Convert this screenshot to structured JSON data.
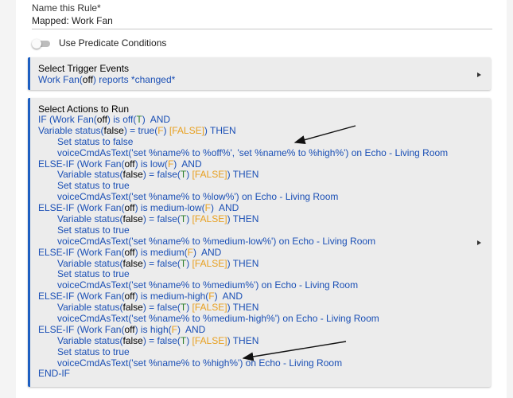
{
  "form": {
    "name_label": "Name this Rule*",
    "name_value": "Mapped: Work Fan",
    "predicate_label": "Use Predicate Conditions"
  },
  "triggers": {
    "title": "Select Trigger Events",
    "line_device": "Work Fan(",
    "line_state": "off",
    "line_rest": ") reports *changed*"
  },
  "actions": {
    "title": "Select Actions to Run",
    "lines": [
      {
        "indent": false,
        "segments": [
          [
            "blue",
            "IF (Work Fan("
          ],
          [
            "black",
            "off"
          ],
          [
            "blue",
            ") is off("
          ],
          [
            "green",
            "T"
          ],
          [
            "blue",
            ")  AND"
          ]
        ]
      },
      {
        "indent": false,
        "segments": [
          [
            "blue",
            "Variable status("
          ],
          [
            "black",
            "false"
          ],
          [
            "blue",
            ") = true("
          ],
          [
            "orange",
            "F"
          ],
          [
            "blue",
            ") "
          ],
          [
            "orange",
            "[FALSE]"
          ],
          [
            "blue",
            ") THEN"
          ]
        ]
      },
      {
        "indent": true,
        "segments": [
          [
            "blue",
            "Set status to false"
          ]
        ]
      },
      {
        "indent": true,
        "segments": [
          [
            "blue",
            "voiceCmdAsText('set %name% to %off%', 'set %name% to %high%') on Echo - Living Room"
          ]
        ]
      },
      {
        "indent": false,
        "segments": [
          [
            "blue",
            "ELSE-IF (Work Fan("
          ],
          [
            "black",
            "off"
          ],
          [
            "blue",
            ") is low("
          ],
          [
            "orange",
            "F"
          ],
          [
            "blue",
            ")  AND"
          ]
        ]
      },
      {
        "indent": true,
        "segments": [
          [
            "blue",
            "Variable status("
          ],
          [
            "black",
            "false"
          ],
          [
            "blue",
            ") = false("
          ],
          [
            "green",
            "T"
          ],
          [
            "blue",
            ") "
          ],
          [
            "orange",
            "[FALSE]"
          ],
          [
            "blue",
            ") THEN"
          ]
        ]
      },
      {
        "indent": true,
        "segments": [
          [
            "blue",
            "Set status to true"
          ]
        ]
      },
      {
        "indent": true,
        "segments": [
          [
            "blue",
            "voiceCmdAsText('set %name% to %low%') on Echo - Living Room"
          ]
        ]
      },
      {
        "indent": false,
        "segments": [
          [
            "blue",
            "ELSE-IF (Work Fan("
          ],
          [
            "black",
            "off"
          ],
          [
            "blue",
            ") is medium-low("
          ],
          [
            "orange",
            "F"
          ],
          [
            "blue",
            ")  AND"
          ]
        ]
      },
      {
        "indent": true,
        "segments": [
          [
            "blue",
            "Variable status("
          ],
          [
            "black",
            "false"
          ],
          [
            "blue",
            ") = false("
          ],
          [
            "green",
            "T"
          ],
          [
            "blue",
            ") "
          ],
          [
            "orange",
            "[FALSE]"
          ],
          [
            "blue",
            ") THEN"
          ]
        ]
      },
      {
        "indent": true,
        "segments": [
          [
            "blue",
            "Set status to true"
          ]
        ]
      },
      {
        "indent": true,
        "segments": [
          [
            "blue",
            "voiceCmdAsText('set %name% to %medium-low%') on Echo - Living Room"
          ]
        ]
      },
      {
        "indent": false,
        "segments": [
          [
            "blue",
            "ELSE-IF (Work Fan("
          ],
          [
            "black",
            "off"
          ],
          [
            "blue",
            ") is medium("
          ],
          [
            "orange",
            "F"
          ],
          [
            "blue",
            ")  AND"
          ]
        ]
      },
      {
        "indent": true,
        "segments": [
          [
            "blue",
            "Variable status("
          ],
          [
            "black",
            "false"
          ],
          [
            "blue",
            ") = false("
          ],
          [
            "green",
            "T"
          ],
          [
            "blue",
            ") "
          ],
          [
            "orange",
            "[FALSE]"
          ],
          [
            "blue",
            ") THEN"
          ]
        ]
      },
      {
        "indent": true,
        "segments": [
          [
            "blue",
            "Set status to true"
          ]
        ]
      },
      {
        "indent": true,
        "segments": [
          [
            "blue",
            "voiceCmdAsText('set %name% to %medium%') on Echo - Living Room"
          ]
        ]
      },
      {
        "indent": false,
        "segments": [
          [
            "blue",
            "ELSE-IF (Work Fan("
          ],
          [
            "black",
            "off"
          ],
          [
            "blue",
            ") is medium-high("
          ],
          [
            "orange",
            "F"
          ],
          [
            "blue",
            ")  AND"
          ]
        ]
      },
      {
        "indent": true,
        "segments": [
          [
            "blue",
            "Variable status("
          ],
          [
            "black",
            "false"
          ],
          [
            "blue",
            ") = false("
          ],
          [
            "green",
            "T"
          ],
          [
            "blue",
            ") "
          ],
          [
            "orange",
            "[FALSE]"
          ],
          [
            "blue",
            ") THEN"
          ]
        ]
      },
      {
        "indent": true,
        "segments": [
          [
            "blue",
            "voiceCmdAsText('set %name% to %medium-high%') on Echo - Living Room"
          ]
        ]
      },
      {
        "indent": false,
        "segments": [
          [
            "blue",
            "ELSE-IF (Work Fan("
          ],
          [
            "black",
            "off"
          ],
          [
            "blue",
            ") is high("
          ],
          [
            "orange",
            "F"
          ],
          [
            "blue",
            ")  AND"
          ]
        ]
      },
      {
        "indent": true,
        "segments": [
          [
            "blue",
            "Variable status("
          ],
          [
            "black",
            "false"
          ],
          [
            "blue",
            ") = false("
          ],
          [
            "green",
            "T"
          ],
          [
            "blue",
            ") "
          ],
          [
            "orange",
            "[FALSE]"
          ],
          [
            "blue",
            ") THEN"
          ]
        ]
      },
      {
        "indent": true,
        "segments": [
          [
            "blue",
            "Set status to true"
          ]
        ]
      },
      {
        "indent": true,
        "segments": [
          [
            "blue",
            "voiceCmdAsText('set %name% to %high%') on Echo - Living Room"
          ]
        ]
      },
      {
        "indent": false,
        "segments": [
          [
            "blue",
            "END-IF"
          ]
        ]
      }
    ]
  },
  "colors": {
    "accent": "#1e5fc1",
    "text_blue": "#1a4fb5",
    "true_green": "#2a7d2a",
    "false_orange": "#e8a020",
    "panel_bg": "#ececec"
  },
  "icons": {
    "expand": "caret-right-icon",
    "annotation": "arrow-icon"
  }
}
